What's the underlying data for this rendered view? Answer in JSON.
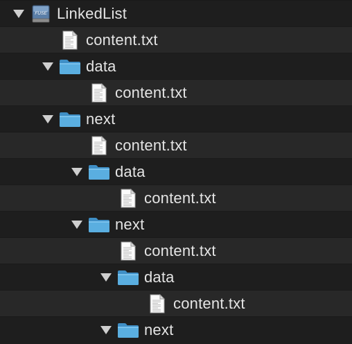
{
  "tree": {
    "rows": [
      {
        "type": "disk",
        "label": "LinkedList",
        "icon": "fuse-disk-icon",
        "expanded": true,
        "depth": 0
      },
      {
        "type": "file",
        "label": "content.txt",
        "icon": "text-file-icon",
        "depth": 1
      },
      {
        "type": "folder",
        "label": "data",
        "icon": "folder-icon",
        "expanded": true,
        "depth": 1
      },
      {
        "type": "file",
        "label": "content.txt",
        "icon": "text-file-icon",
        "depth": 2
      },
      {
        "type": "folder",
        "label": "next",
        "icon": "folder-icon",
        "expanded": true,
        "depth": 1
      },
      {
        "type": "file",
        "label": "content.txt",
        "icon": "text-file-icon",
        "depth": 2
      },
      {
        "type": "folder",
        "label": "data",
        "icon": "folder-icon",
        "expanded": true,
        "depth": 2
      },
      {
        "type": "file",
        "label": "content.txt",
        "icon": "text-file-icon",
        "depth": 3
      },
      {
        "type": "folder",
        "label": "next",
        "icon": "folder-icon",
        "expanded": true,
        "depth": 2
      },
      {
        "type": "file",
        "label": "content.txt",
        "icon": "text-file-icon",
        "depth": 3
      },
      {
        "type": "folder",
        "label": "data",
        "icon": "folder-icon",
        "expanded": true,
        "depth": 3
      },
      {
        "type": "file",
        "label": "content.txt",
        "icon": "text-file-icon",
        "depth": 4
      },
      {
        "type": "folder",
        "label": "next",
        "icon": "folder-icon",
        "expanded": true,
        "depth": 3
      }
    ],
    "disk_badge_text": "FUSE",
    "colors": {
      "background": "#1e1e1e",
      "row_alt": "#282828",
      "text": "#e4e4e4",
      "triangle": "#cfcfcf",
      "folder": "#5aaee0",
      "folder_dark": "#3f8fc6"
    }
  }
}
